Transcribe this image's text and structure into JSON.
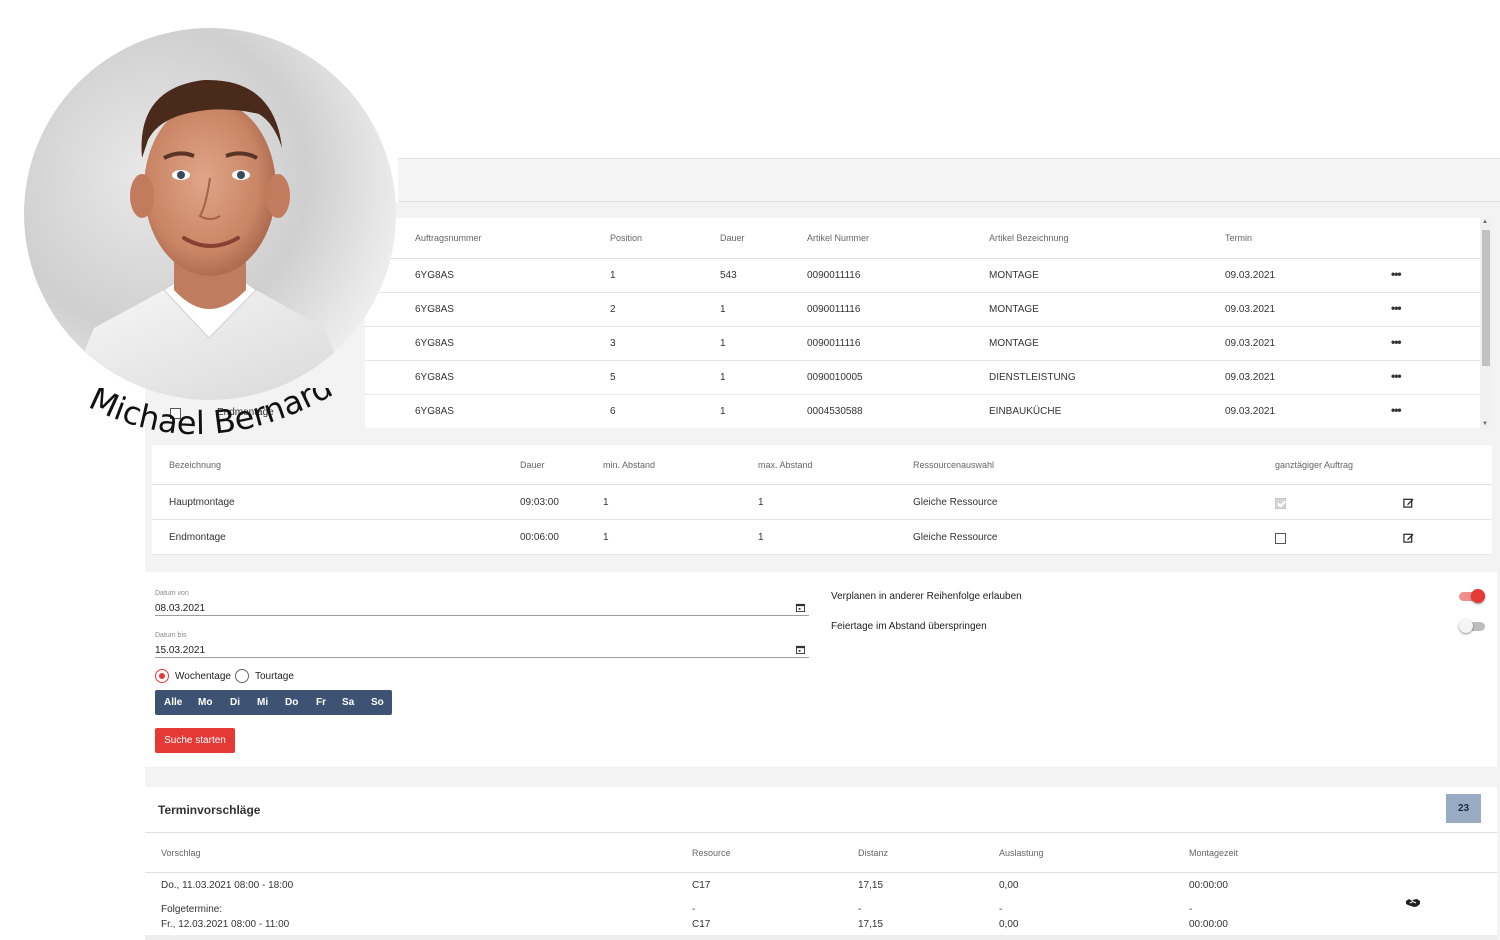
{
  "person": {
    "name": "Michael Bernard",
    "photo_icon": "portrait-photo"
  },
  "orders": {
    "headers": [
      "Auftragsnummer",
      "Position",
      "Dauer",
      "Artikel Nummer",
      "Artikel Bezeichnung",
      "Termin"
    ],
    "rows": [
      {
        "auftrag": "6YG8AS",
        "position": "1",
        "dauer": "543",
        "artikel_nummer": "0090011116",
        "bezeichnung": "MONTAGE",
        "termin": "09.03.2021"
      },
      {
        "auftrag": "6YG8AS",
        "position": "2",
        "dauer": "1",
        "artikel_nummer": "0090011116",
        "bezeichnung": "MONTAGE",
        "termin": "09.03.2021"
      },
      {
        "auftrag": "6YG8AS",
        "position": "3",
        "dauer": "1",
        "artikel_nummer": "0090011116",
        "bezeichnung": "MONTAGE",
        "termin": "09.03.2021"
      },
      {
        "auftrag": "6YG8AS",
        "position": "5",
        "dauer": "1",
        "artikel_nummer": "0090010005",
        "bezeichnung": "DIENSTLEISTUNG",
        "termin": "09.03.2021"
      },
      {
        "auftrag": "6YG8AS",
        "position": "6",
        "dauer": "1",
        "artikel_nummer": "0004530588",
        "bezeichnung": "EINBAUKÜCHE",
        "termin": "09.03.2021"
      }
    ],
    "row_menu_icon": "more-horizontal-icon"
  },
  "step_selector": {
    "label": "Endmontage",
    "checked": false
  },
  "steps": {
    "headers": [
      "Bezeichnung",
      "Dauer",
      "min. Abstand",
      "max. Abstand",
      "Ressourcenauswahl",
      "ganztägiger Auftrag"
    ],
    "rows": [
      {
        "bezeichnung": "Hauptmontage",
        "dauer": "09:03:00",
        "min": "1",
        "max": "1",
        "ressource": "Gleiche Ressource",
        "ganztaegig": true
      },
      {
        "bezeichnung": "Endmontage",
        "dauer": "00:06:00",
        "min": "1",
        "max": "1",
        "ressource": "Gleiche Ressource",
        "ganztaegig": false
      }
    ],
    "edit_icon": "edit-icon"
  },
  "search": {
    "datum_von": {
      "label": "Datum von",
      "value": "08.03.2021"
    },
    "datum_bis": {
      "label": "Datum bis",
      "value": "15.03.2021"
    },
    "mode": {
      "wochentage": "Wochentage",
      "tourtage": "Tourtage",
      "selected": "wochentage"
    },
    "days": [
      "Alle",
      "Mo",
      "Di",
      "Mi",
      "Do",
      "Fr",
      "Sa",
      "So"
    ],
    "button": "Suche starten",
    "options": [
      {
        "label": "Verplanen in anderer Reihenfolge erlauben",
        "on": true
      },
      {
        "label": "Feiertage im Abstand überspringen",
        "on": false
      }
    ]
  },
  "results": {
    "title": "Terminvorschläge",
    "count": "23",
    "headers": [
      "Vorschlag",
      "Resource",
      "Distanz",
      "Auslastung",
      "Montagezeit"
    ],
    "first": {
      "vorschlag": "Do., 11.03.2021 08:00 - 18:00",
      "resource": "C17",
      "distanz": "17,15",
      "auslastung": "0,00",
      "montagezeit": "00:00:00"
    },
    "folge_label": "Folgetermine:",
    "folge_dash": "-",
    "second": {
      "vorschlag": "Fr., 12.03.2021 08:00 - 11:00",
      "resource": "C17",
      "distanz": "17,15",
      "auslastung": "0,00",
      "montagezeit": "00:00:00"
    },
    "action_icon": "handshake-icon"
  },
  "colors": {
    "accent_red": "#e53935",
    "day_bar": "#3e5374",
    "badge": "#99aac3"
  }
}
